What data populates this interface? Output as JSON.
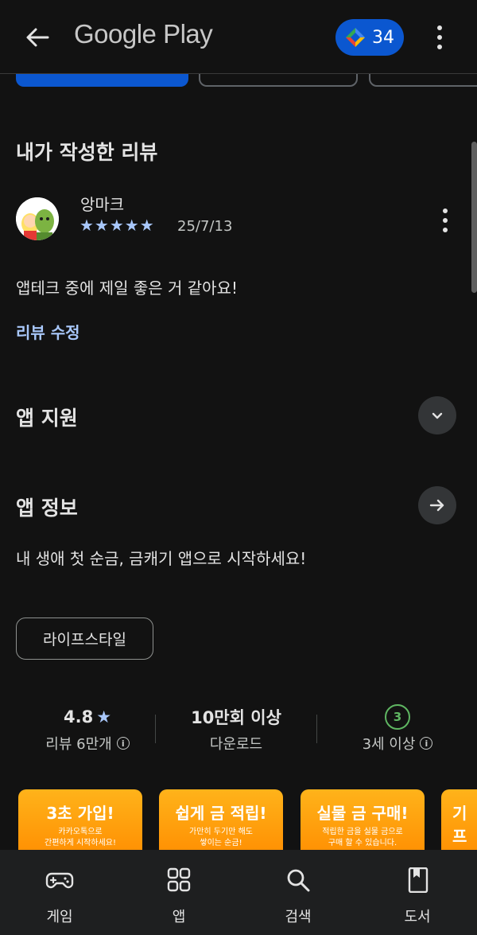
{
  "header": {
    "title": "Google Play",
    "points": "34"
  },
  "review_section": {
    "title": "내가 작성한 리뷰",
    "reviewer": "앙마크",
    "stars": "★★★★★",
    "date": "25/7/13",
    "text": "앱테크 중에 제일 좋은 거 같아요!",
    "edit_label": "리뷰 수정"
  },
  "app_support": {
    "title": "앱 지원"
  },
  "app_info": {
    "title": "앱 정보",
    "description": "내 생애 첫 순금, 금캐기 앱으로 시작하세요!",
    "category_chip": "라이프스타일"
  },
  "stats": {
    "rating": "4.8",
    "rating_star": "★",
    "reviews_label": "리뷰 6만개",
    "downloads": "10만회 이상",
    "downloads_label": "다운로드",
    "age": "3",
    "age_label": "3세 이상"
  },
  "screenshots": [
    {
      "heading": "3초 가입!",
      "sub1": "카카오톡으로",
      "sub2": "간편하게 시작하세요!"
    },
    {
      "heading": "쉽게 금 적립!",
      "sub1": "가만히 두기만 해도",
      "sub2": "쌓이는 순금!"
    },
    {
      "heading": "실물 금 구매!",
      "sub1": "적립한 금을 실물 금으로",
      "sub2": "구매 할 수 있습니다."
    },
    {
      "heading": "기프",
      "sub1": "기",
      "sub2": "기프"
    }
  ],
  "bottom_nav": {
    "games": "게임",
    "apps": "앱",
    "search": "검색",
    "books": "도서"
  },
  "colors": {
    "background": "#121212",
    "accent_blue": "#0b57d0",
    "link_blue": "#a8c7fa",
    "age_green": "#5fb662",
    "screenshot_orange": "#ff9a00"
  }
}
